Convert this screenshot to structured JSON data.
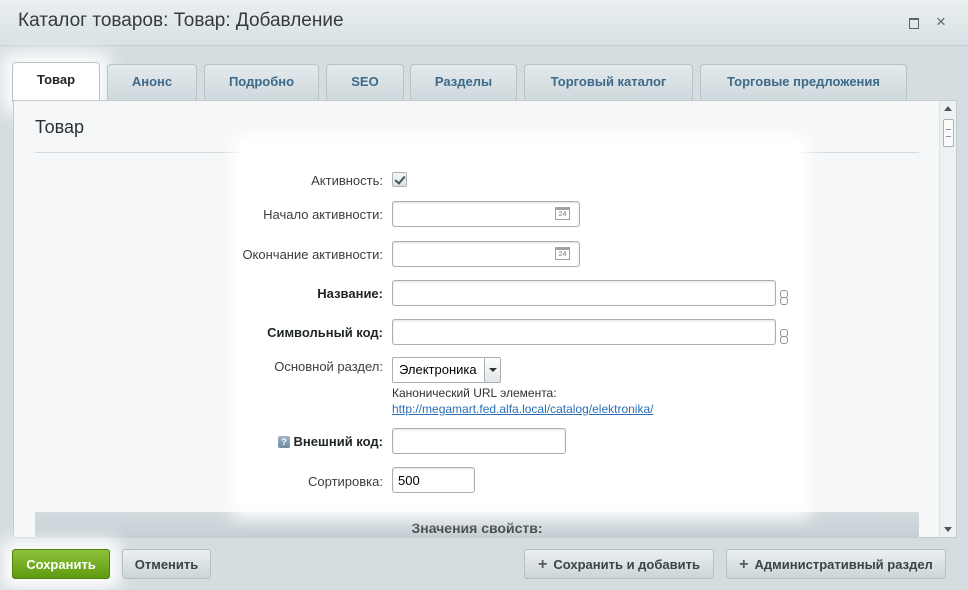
{
  "window": {
    "title": "Каталог товаров: Товар: Добавление",
    "maximize_label": "",
    "close_label": "×"
  },
  "tabs": [
    {
      "label": "Товар",
      "active": true
    },
    {
      "label": "Анонс"
    },
    {
      "label": "Подробно"
    },
    {
      "label": "SEO"
    },
    {
      "label": "Разделы"
    },
    {
      "label": "Торговый каталог"
    },
    {
      "label": "Торговые предложения"
    }
  ],
  "section": {
    "title": "Товар"
  },
  "form": {
    "active_label": "Активность:",
    "active_checked": true,
    "start_label": "Начало активности:",
    "start_value": "",
    "end_label": "Окончание активности:",
    "end_value": "",
    "calendar_icon_text": "24",
    "name_label": "Название:",
    "name_value": "",
    "code_label": "Символьный код:",
    "code_value": "",
    "section_label": "Основной раздел:",
    "section_value": "Электроника",
    "canonical_label": "Канонический URL элемента:",
    "canonical_url": "http://megamart.fed.alfa.local/catalog/elektronika/",
    "external_code_label": "Внешний код:",
    "external_code_value": "",
    "help_icon_text": "?",
    "sort_label": "Сортировка:",
    "sort_value": "500"
  },
  "properties_header": "Значения свойств:",
  "buttons": {
    "save": "Сохранить",
    "cancel": "Отменить",
    "save_add": "Сохранить и добавить",
    "admin_section": "Административный раздел",
    "plus": "+"
  },
  "colors": {
    "save_button": "#6fa820",
    "tab_text": "#3e6a8a",
    "link": "#2a6fb7"
  }
}
